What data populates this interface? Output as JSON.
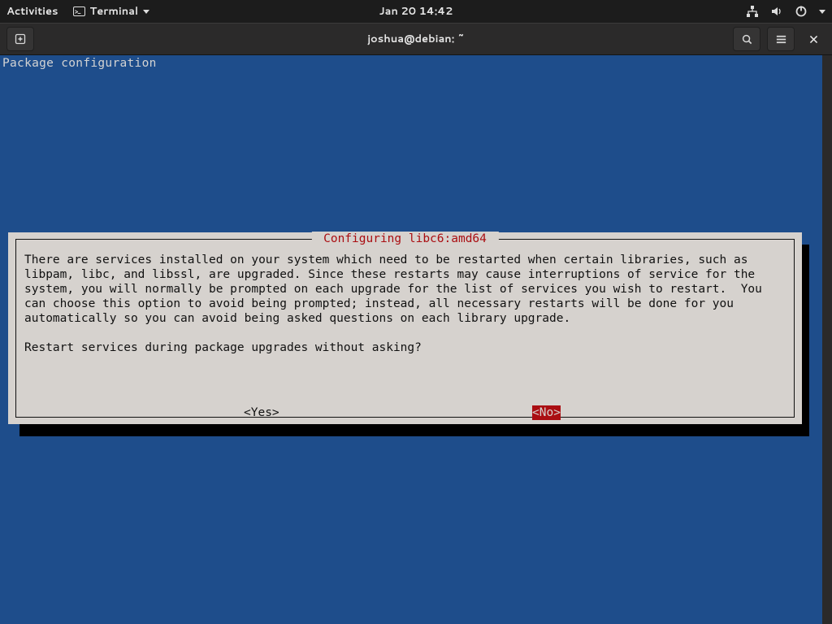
{
  "top_bar": {
    "activities": "Activities",
    "app_label": "Terminal",
    "clock": "Jan 20  14:42"
  },
  "window": {
    "title": "joshua@debian: ~"
  },
  "terminal": {
    "header": "Package configuration"
  },
  "dialog": {
    "title": " Configuring libc6:amd64 ",
    "body": "There are services installed on your system which need to be restarted when certain libraries, such as libpam, libc, and libssl, are upgraded. Since these restarts may cause interruptions of service for the system, you will normally be prompted on each upgrade for the list of services you wish to restart.  You can choose this option to avoid being prompted; instead, all necessary restarts will be done for you automatically so you can avoid being asked questions on each library upgrade.\n\nRestart services during package upgrades without asking?",
    "yes_label": "<Yes>",
    "no_label": "<No>",
    "selected": "no"
  }
}
